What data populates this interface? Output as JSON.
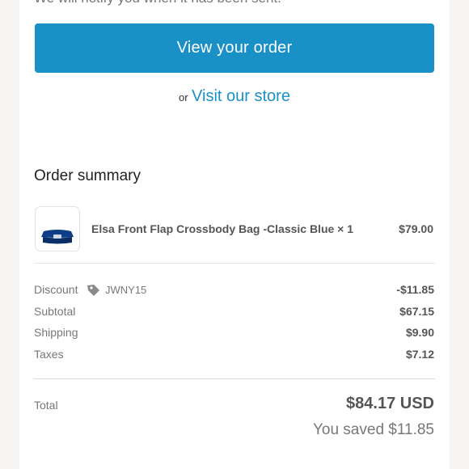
{
  "header": {
    "cutoff_text": "We will notify you when it has been sent."
  },
  "actions": {
    "view_order_label": "View your order",
    "or_text": "or",
    "visit_store_label": "Visit our store"
  },
  "summary": {
    "title": "Order summary",
    "item": {
      "name": "Elsa Front Flap Crossbody Bag -Classic Blue × 1",
      "price": "$79.00",
      "thumbnail_icon": "bag-thumbnail-icon"
    },
    "lines": [
      {
        "label": "Discount",
        "value": "-$11.85",
        "code": "JWNY15"
      },
      {
        "label": "Subtotal",
        "value": "$67.15"
      },
      {
        "label": "Shipping",
        "value": "$9.90"
      },
      {
        "label": "Taxes",
        "value": "$7.12"
      }
    ],
    "total": {
      "label": "Total",
      "value": "$84.17 USD",
      "saved": "You saved $11.85"
    }
  },
  "colors": {
    "accent": "#1990c6",
    "background": "#f6f5f3",
    "card": "#ffffff"
  }
}
